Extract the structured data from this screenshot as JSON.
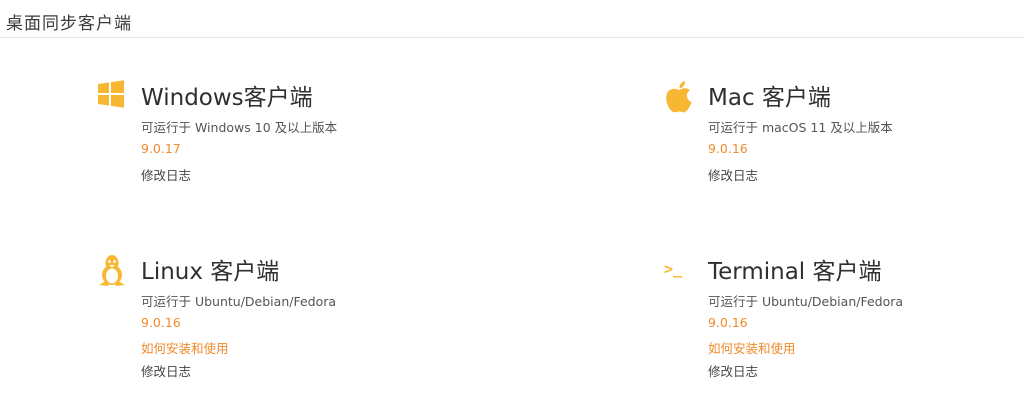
{
  "header": {
    "title": "桌面同步客户端"
  },
  "colors": {
    "accent": "#f08a2b",
    "icon": "#f7b733"
  },
  "clients": [
    {
      "id": "windows",
      "icon": "windows-icon",
      "title": "Windows客户端",
      "desc": "可运行于 Windows 10 及以上版本",
      "version": "9.0.17",
      "changelog": "修改日志"
    },
    {
      "id": "mac",
      "icon": "apple-icon",
      "title": "Mac 客户端",
      "desc": "可运行于 macOS 11 及以上版本",
      "version": "9.0.16",
      "changelog": "修改日志"
    },
    {
      "id": "linux",
      "icon": "linux-penguin-icon",
      "title": "Linux 客户端",
      "desc": "可运行于 Ubuntu/Debian/Fedora",
      "version": "9.0.16",
      "howto": "如何安装和使用",
      "changelog": "修改日志"
    },
    {
      "id": "terminal",
      "icon": "terminal-icon",
      "icon_glyph": ">_",
      "title": "Terminal 客户端",
      "desc": "可运行于 Ubuntu/Debian/Fedora",
      "version": "9.0.16",
      "howto": "如何安装和使用",
      "changelog": "修改日志"
    }
  ]
}
